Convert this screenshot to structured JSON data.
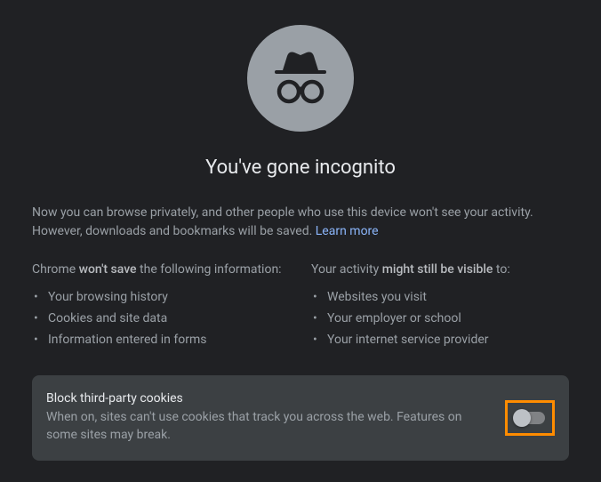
{
  "heading": "You've gone incognito",
  "intro_prefix": "Now you can browse privately, and other people who use this device won't see your activity. However, downloads and bookmarks will be saved. ",
  "learn_more": "Learn more",
  "left": {
    "title_prefix": "Chrome ",
    "title_bold": "won't save",
    "title_suffix": " the following information:",
    "items": [
      "Your browsing history",
      "Cookies and site data",
      "Information entered in forms"
    ]
  },
  "right": {
    "title_prefix": "Your activity ",
    "title_bold": "might still be visible",
    "title_suffix": " to:",
    "items": [
      "Websites you visit",
      "Your employer or school",
      "Your internet service provider"
    ]
  },
  "card": {
    "title": "Block third-party cookies",
    "desc": "When on, sites can't use cookies that track you across the web. Features on some sites may break."
  }
}
